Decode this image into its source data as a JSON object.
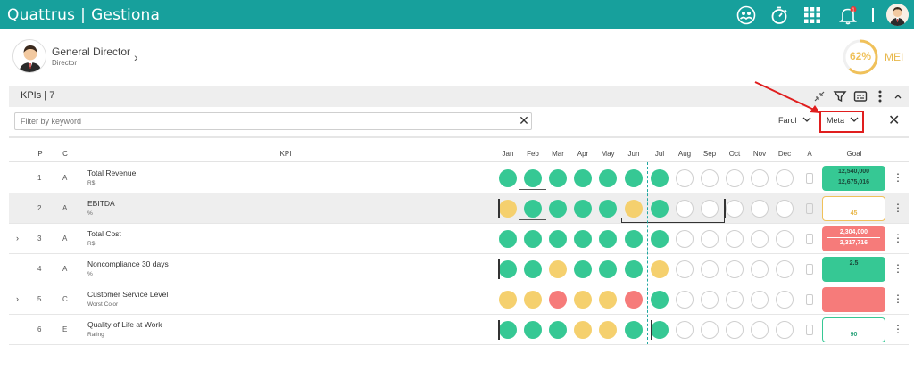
{
  "app": {
    "brand": "Quattrus",
    "module": "Gestiona"
  },
  "topbar": {
    "icons": [
      "meeting-icon",
      "stopwatch-icon",
      "apps-grid-icon",
      "notification-bell-icon",
      "user-avatar-icon"
    ],
    "notification_count": "1"
  },
  "profile": {
    "title": "General Director",
    "subtitle": "Director"
  },
  "mei": {
    "percent_label": "62%",
    "label": "MEI",
    "value": 0.62,
    "color": "#f0c15a"
  },
  "kpis": {
    "title": "KPIs | 7"
  },
  "filter": {
    "placeholder": "Filter by keyword"
  },
  "dropdowns": {
    "farol": "Farol",
    "meta": "Meta"
  },
  "table": {
    "headers": {
      "p": "P",
      "c": "C",
      "kpi": "KPI",
      "a": "A",
      "goal": "Goal"
    },
    "months": [
      "Jan",
      "Feb",
      "Mar",
      "Apr",
      "May",
      "Jun",
      "Jul",
      "Aug",
      "Sep",
      "Oct",
      "Nov",
      "Dec"
    ],
    "rows": [
      {
        "p": "1",
        "c": "A",
        "name": "Total Revenue",
        "unit": "R$",
        "expandable": false,
        "grey": false,
        "status": [
          "green",
          "green",
          "green",
          "green",
          "green",
          "green",
          "green",
          "empty",
          "empty",
          "empty",
          "empty",
          "empty"
        ],
        "goal": {
          "style": "green",
          "top": "12,540,000",
          "bottom": "12,675,016"
        }
      },
      {
        "p": "2",
        "c": "A",
        "name": "EBITDA",
        "unit": "%",
        "expandable": false,
        "grey": true,
        "status": [
          "yellow",
          "green",
          "green",
          "green",
          "green",
          "yellow",
          "green",
          "empty",
          "empty",
          "empty",
          "empty",
          "empty"
        ],
        "goal": {
          "style": "yellow-outline",
          "value": "45"
        }
      },
      {
        "p": "3",
        "c": "A",
        "name": "Total Cost",
        "unit": "R$",
        "expandable": true,
        "grey": false,
        "status": [
          "green",
          "green",
          "green",
          "green",
          "green",
          "green",
          "green",
          "empty",
          "empty",
          "empty",
          "empty",
          "empty"
        ],
        "goal": {
          "style": "red",
          "top": "2,304,000",
          "bottom": "2,317,716"
        }
      },
      {
        "p": "4",
        "c": "A",
        "name": "Noncompliance 30 days",
        "unit": "%",
        "expandable": false,
        "grey": false,
        "status": [
          "green",
          "green",
          "yellow",
          "green",
          "green",
          "green",
          "yellow",
          "empty",
          "empty",
          "empty",
          "empty",
          "empty"
        ],
        "goal": {
          "style": "green",
          "value_top": "2.5"
        }
      },
      {
        "p": "5",
        "c": "C",
        "name": "Customer Service Level",
        "unit": "Worst Color",
        "expandable": true,
        "grey": false,
        "status": [
          "yellow",
          "yellow",
          "red",
          "yellow",
          "yellow",
          "red",
          "green",
          "empty",
          "empty",
          "empty",
          "empty",
          "empty"
        ],
        "goal": {
          "style": "red"
        }
      },
      {
        "p": "6",
        "c": "E",
        "name": "Quality of Life at Work",
        "unit": "Rating",
        "expandable": false,
        "grey": false,
        "status": [
          "green",
          "green",
          "green",
          "yellow",
          "yellow",
          "green",
          "green",
          "empty",
          "empty",
          "empty",
          "empty",
          "empty"
        ],
        "goal": {
          "style": "green-outline",
          "value": "90"
        }
      }
    ]
  },
  "colors": {
    "accent": "#17a09c",
    "green": "#36c894",
    "yellow": "#f5d06e",
    "red": "#f67b7a",
    "highlight": "#e01e1e"
  }
}
